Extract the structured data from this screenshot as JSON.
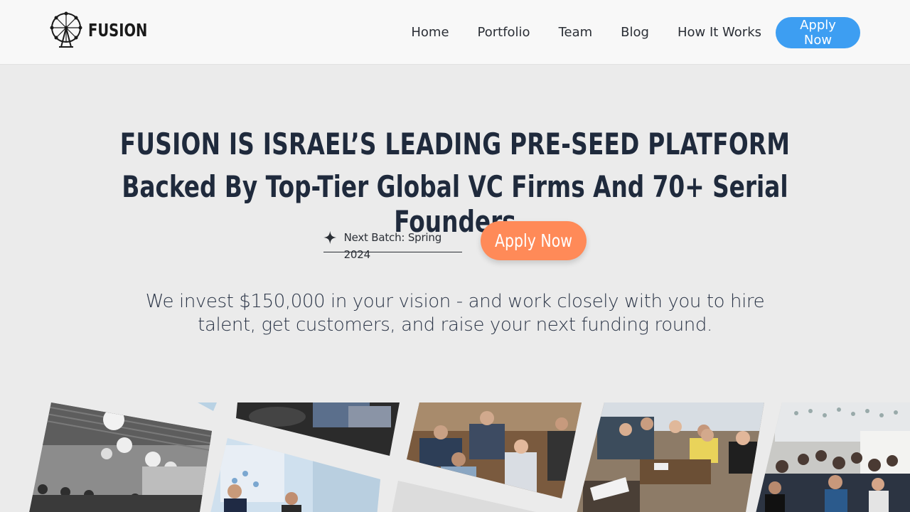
{
  "header": {
    "logo_text": "FUSION",
    "nav": [
      "Home",
      "Portfolio",
      "Team",
      "Blog",
      "How It Works"
    ],
    "apply_label": "Apply Now"
  },
  "hero": {
    "title_line1": "FUSION IS ISRAEL’S LEADING PRE-SEED PLATFORM",
    "title_line2": "Backed By Top-Tier Global VC Firms And 70+ Serial Founders",
    "batch_label": "Next Batch: Spring 2024",
    "cta_label": "Apply Now",
    "description": "We invest $150,000 in your vision - and work closely with you to hire talent, get customers, and raise your next funding round."
  },
  "colors": {
    "accent_blue": "#3d9ef2",
    "accent_orange": "#ff8a58",
    "heading": "#1f2a3c",
    "page_bg": "#ebebeb"
  },
  "gallery": {
    "photos": [
      "conference-room-photo",
      "panel-event-photo",
      "team-meeting-photo",
      "lounge-discussion-photo",
      "crowd-event-photo"
    ]
  }
}
